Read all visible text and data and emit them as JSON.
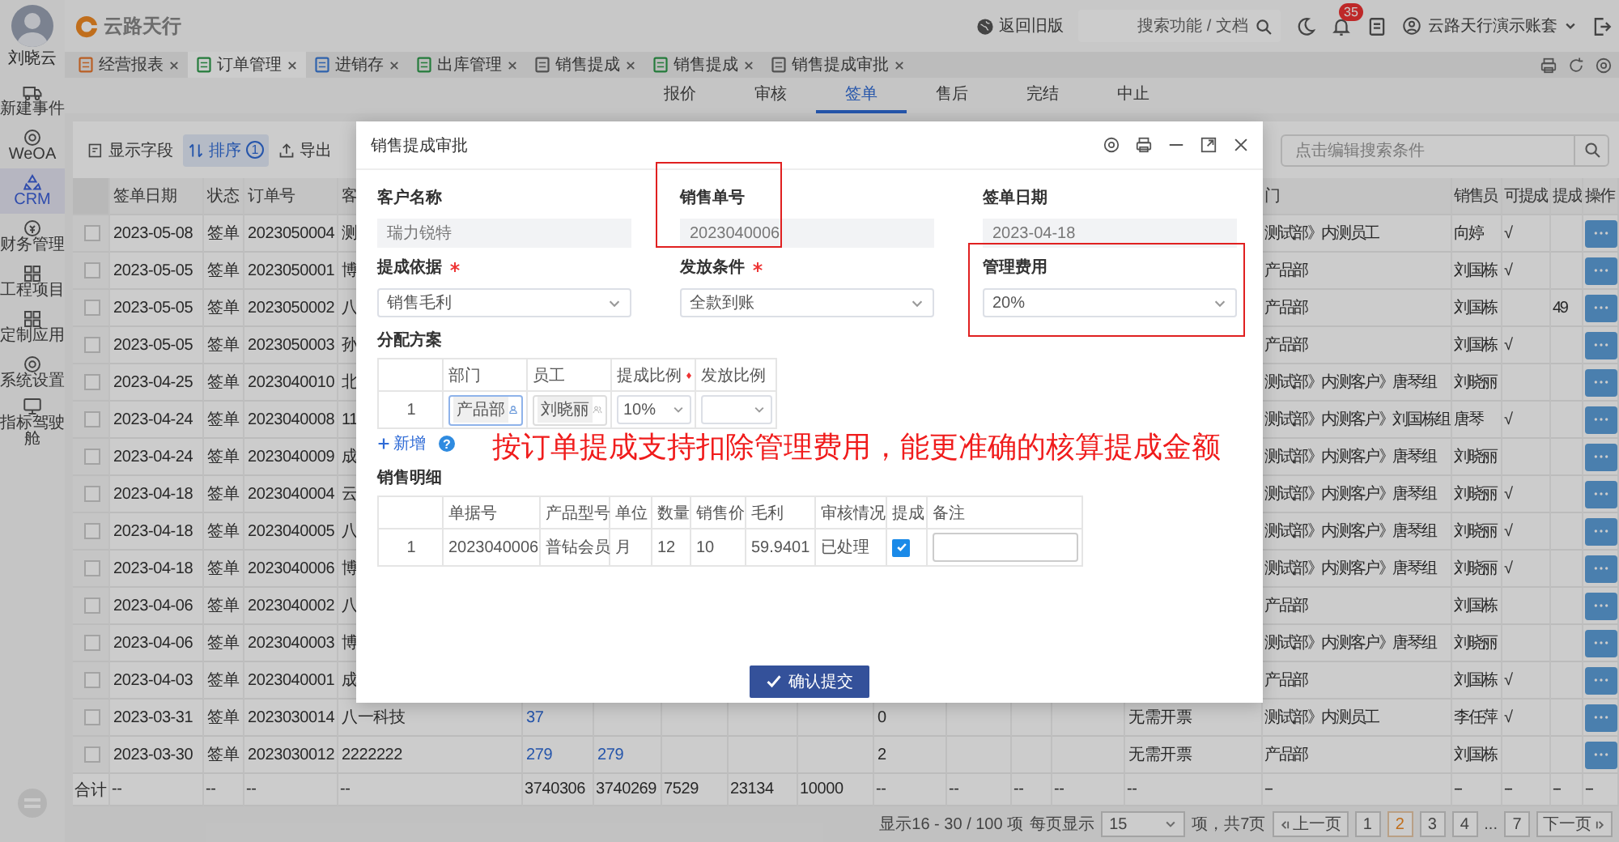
{
  "user": {
    "name": "刘晓云"
  },
  "brand": {
    "name": "云路天行"
  },
  "header": {
    "legacy_link": "返回旧版",
    "search": {
      "placeholder": "搜索功能 / 文档"
    },
    "notifications": "35",
    "account": "云路天行演示账套"
  },
  "sidebar": {
    "items": [
      {
        "label": "新建事件",
        "selected": false
      },
      {
        "label": "WeOA",
        "selected": false
      },
      {
        "label": "CRM",
        "selected": true
      },
      {
        "label": "财务管理",
        "selected": false
      },
      {
        "label": "工程项目",
        "selected": false
      },
      {
        "label": "定制应用",
        "selected": false
      },
      {
        "label": "系统设置",
        "selected": false
      },
      {
        "label": "指标驾驶舱",
        "selected": false
      }
    ]
  },
  "tabs": [
    {
      "label": "经营报表",
      "selected": false
    },
    {
      "label": "订单管理",
      "selected": true
    },
    {
      "label": "进销存",
      "selected": false
    },
    {
      "label": "出库管理",
      "selected": false
    },
    {
      "label": "销售提成",
      "selected": false
    },
    {
      "label": "销售提成",
      "selected": false
    },
    {
      "label": "销售提成审批",
      "selected": false
    }
  ],
  "subtabs": [
    {
      "label": "报价",
      "selected": false
    },
    {
      "label": "审核",
      "selected": false
    },
    {
      "label": "签单",
      "selected": true
    },
    {
      "label": "售后",
      "selected": false
    },
    {
      "label": "完结",
      "selected": false
    },
    {
      "label": "中止",
      "selected": false
    }
  ],
  "toolbar": {
    "fields": "显示字段",
    "sort": {
      "label": "排序",
      "count": "1",
      "selected": true
    },
    "export": "导出",
    "search": {
      "placeholder": "点击编辑搜索条件"
    }
  },
  "table": {
    "columns": [
      "签单日期",
      "状态",
      "订单号",
      "客",
      "门",
      "销售员",
      "可提成",
      "提成",
      "操作"
    ],
    "rows": [
      {
        "checked": false,
        "date": "2023-05-08",
        "status": "签单",
        "order_no": "2023050004",
        "customer": "测",
        "department": "测试部》内测员工",
        "salesperson": "向婷",
        "commissionable": "√"
      },
      {
        "checked": false,
        "date": "2023-05-05",
        "status": "签单",
        "order_no": "2023050001",
        "customer": "博",
        "department": "产品部",
        "salesperson": "刘国栋",
        "commissionable": "√"
      },
      {
        "checked": false,
        "date": "2023-05-05",
        "status": "签单",
        "order_no": "2023050002",
        "customer": "八",
        "department": "产品部",
        "salesperson": "刘国栋",
        "commission": "49"
      },
      {
        "checked": false,
        "date": "2023-05-05",
        "status": "签单",
        "order_no": "2023050003",
        "customer": "孙",
        "department": "产品部",
        "salesperson": "刘国栋",
        "commissionable": "√"
      },
      {
        "checked": false,
        "date": "2023-04-25",
        "status": "签单",
        "order_no": "2023040010",
        "customer": "北",
        "department": "测试部》内测客户》唐琴组",
        "salesperson": "刘晓丽"
      },
      {
        "checked": false,
        "date": "2023-04-24",
        "status": "签单",
        "order_no": "2023040008",
        "customer": "11",
        "department": "测试部》内测客户》刘国栋组",
        "salesperson": "唐琴",
        "commissionable": "√"
      },
      {
        "checked": false,
        "date": "2023-04-24",
        "status": "签单",
        "order_no": "2023040009",
        "customer": "成",
        "department": "测试部》内测客户》唐琴组",
        "salesperson": "刘晓丽"
      },
      {
        "checked": false,
        "date": "2023-04-18",
        "status": "签单",
        "order_no": "2023040004",
        "customer": "云",
        "department": "测试部》内测客户》唐琴组",
        "salesperson": "刘晓丽",
        "commissionable": "√"
      },
      {
        "checked": false,
        "date": "2023-04-18",
        "status": "签单",
        "order_no": "2023040005",
        "customer": "八",
        "department": "测试部》内测客户》唐琴组",
        "salesperson": "刘晓丽",
        "commissionable": "√"
      },
      {
        "checked": false,
        "date": "2023-04-18",
        "status": "签单",
        "order_no": "2023040006",
        "customer": "博",
        "department": "测试部》内测客户》唐琴组",
        "salesperson": "刘晓丽",
        "commissionable": "√"
      },
      {
        "checked": false,
        "date": "2023-04-06",
        "status": "签单",
        "order_no": "2023040002",
        "customer": "八",
        "department": "产品部",
        "salesperson": "刘国栋"
      },
      {
        "checked": false,
        "date": "2023-04-06",
        "status": "签单",
        "order_no": "2023040003",
        "customer": "博",
        "department": "测试部》内测客户》唐琴组",
        "salesperson": "刘晓丽"
      },
      {
        "checked": false,
        "date": "2023-04-03",
        "status": "签单",
        "order_no": "2023040001",
        "customer": "成",
        "department": "产品部",
        "salesperson": "刘国栋",
        "commissionable": "√"
      },
      {
        "checked": false,
        "date": "2023-03-31",
        "status": "签单",
        "order_no": "2023030014",
        "customer": "八一科技",
        "column_6": "37",
        "column_11": "0",
        "column_15": "无需开票",
        "department": "测试部》内测员工",
        "salesperson": "李任萍",
        "commissionable": "√"
      },
      {
        "checked": false,
        "date": "2023-03-30",
        "status": "签单",
        "order_no": "2023030012",
        "customer": "2222222",
        "column_6": "279",
        "column_7": "279",
        "column_11": "2",
        "column_15": "无需开票",
        "department": "产品部",
        "salesperson": "刘国栋"
      }
    ],
    "totals": {
      "label": "合计",
      "date": "--",
      "status": "--",
      "order_no": "--",
      "customer": "--",
      "column_6": "3740306",
      "column_7": "3740269",
      "column_8": "7529",
      "column_9": "23134",
      "column_10": "10000",
      "column_11": "--",
      "column_12": "--",
      "column_13": "--",
      "column_14": "--",
      "column_15": "--",
      "department": "--",
      "salesperson": "--",
      "commissionable": "--",
      "commission": "--",
      "actions": "--"
    }
  },
  "pagination": {
    "summary": "显示16 - 30 / 100 项",
    "per_page_label": "每页显示",
    "per_page": "15",
    "pages_total": "项，共7页",
    "prev": "上一页",
    "next": "下一页",
    "pages": [
      {
        "label": "1",
        "kind": "page",
        "selected": false
      },
      {
        "label": "2",
        "kind": "page",
        "selected": true
      },
      {
        "label": "3",
        "kind": "page",
        "selected": false
      },
      {
        "label": "4",
        "kind": "page",
        "selected": false
      },
      {
        "label": "...",
        "kind": "ellipsis",
        "selected": false
      },
      {
        "label": "7",
        "kind": "page",
        "selected": false
      }
    ]
  },
  "dialog": {
    "title": "销售提成审批",
    "fields": [
      {
        "label": "客户名称",
        "value": "瑞力锐特",
        "kind": "readonly",
        "required": false
      },
      {
        "label": "销售单号",
        "value": "2023040006",
        "kind": "readonly",
        "required": false
      },
      {
        "label": "签单日期",
        "value": "2023-04-18",
        "kind": "readonly",
        "required": false
      },
      {
        "label": "提成依据",
        "value": "销售毛利",
        "kind": "select",
        "required": true
      },
      {
        "label": "发放条件",
        "value": "全款到账",
        "kind": "select",
        "required": true
      },
      {
        "label": "管理费用",
        "value": "20%",
        "kind": "select",
        "required": false
      }
    ],
    "allocation": {
      "title": "分配方案",
      "columns": [
        {
          "label": "部门",
          "required": false
        },
        {
          "label": "员工",
          "required": false
        },
        {
          "label": "提成比例",
          "required": true
        },
        {
          "label": "发放比例",
          "required": false
        }
      ],
      "rows": [
        {
          "index": "1",
          "department": "产品部",
          "employee": "刘晓丽",
          "ratio": "10%"
        }
      ],
      "add": "新增",
      "help": "?"
    },
    "details": {
      "title": "销售明细",
      "columns": [
        "单据号",
        "产品型号",
        "单位",
        "数量",
        "销售价",
        "毛利",
        "审核情况",
        "提成",
        "备注"
      ],
      "rows": [
        {
          "index": "1",
          "cells": [
            "2023040006",
            "普钻会员",
            "月",
            "12",
            "10",
            "59.9401",
            "已处理"
          ],
          "commission": true
        }
      ]
    },
    "submit": "确认提交"
  },
  "annotation": {
    "caption": "按订单提成支持扣除管理费用，能更准确的核算提成金额"
  }
}
